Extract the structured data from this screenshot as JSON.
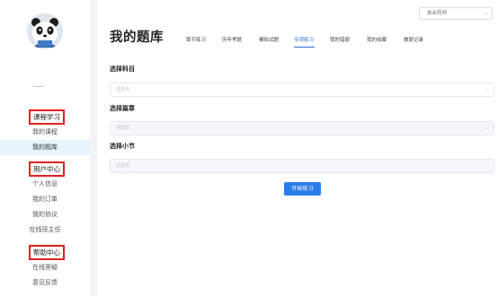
{
  "sidebar": {
    "sections": [
      {
        "title": "课程学习",
        "items": [
          {
            "label": "我的课程",
            "active": false
          },
          {
            "label": "我的题库",
            "active": true
          }
        ]
      },
      {
        "title": "用户中心",
        "items": [
          {
            "label": "个人信息",
            "active": false
          },
          {
            "label": "我的订单",
            "active": false
          },
          {
            "label": "我的协议",
            "active": false
          },
          {
            "label": "在线班主任",
            "active": false
          }
        ]
      },
      {
        "title": "帮助中心",
        "items": [
          {
            "label": "在线答疑",
            "active": false
          },
          {
            "label": "意见反馈",
            "active": false
          }
        ]
      }
    ]
  },
  "main": {
    "title": "我的题库",
    "job_select": {
      "value": "执业药师"
    },
    "tabs": [
      {
        "label": "章节练习",
        "active": false
      },
      {
        "label": "历年考题",
        "active": false
      },
      {
        "label": "模拟试题",
        "active": false
      },
      {
        "label": "专项练习",
        "active": true
      },
      {
        "label": "我的错题",
        "active": false
      },
      {
        "label": "我的收藏",
        "active": false
      },
      {
        "label": "做题记录",
        "active": false
      }
    ],
    "form": {
      "subject": {
        "label": "选择科目",
        "placeholder": "请选择"
      },
      "chapter": {
        "label": "选择篇章",
        "placeholder": "请选择"
      },
      "section": {
        "label": "选择小节",
        "placeholder": "请选择"
      },
      "start_label": "开始练习"
    }
  },
  "colors": {
    "accent": "#2b7de9",
    "section_border": "#e02020",
    "active_item_bg": "#e6f4fb"
  }
}
